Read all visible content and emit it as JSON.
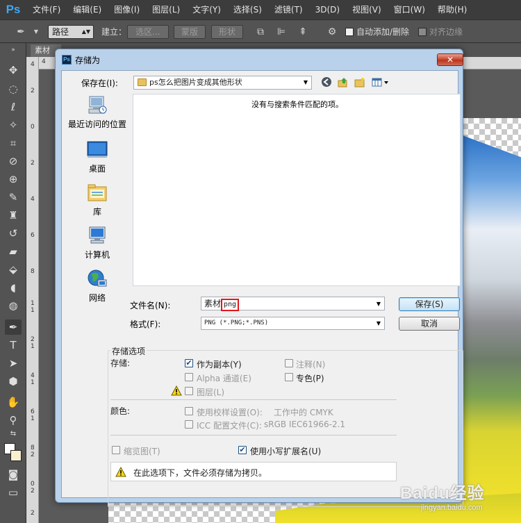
{
  "menubar": {
    "logo": "Ps",
    "items": [
      "文件(F)",
      "编辑(E)",
      "图像(I)",
      "图层(L)",
      "文字(Y)",
      "选择(S)",
      "滤镜(T)",
      "3D(D)",
      "视图(V)",
      "窗口(W)",
      "帮助(H)"
    ]
  },
  "options_bar": {
    "mode_select": "路径",
    "make_label": "建立：",
    "selection_btn": "选区...",
    "mask_btn": "蒙版",
    "shape_btn": "形状",
    "auto_add_delete": "自动添加/删除",
    "align_edges": "对齐边缘"
  },
  "document": {
    "tab_label": "素材",
    "ruler_v": [
      "4",
      "2",
      "0",
      "2",
      "4",
      "6",
      "8",
      "1",
      "1",
      "2",
      "1",
      "4",
      "1",
      "6",
      "1",
      "8",
      "2",
      "0",
      "2",
      "2"
    ],
    "ruler_h_first": "4"
  },
  "dialog": {
    "title": "存储为",
    "close_symbol": "✕",
    "save_in_label": "保存在(I):",
    "location": "ps怎么把图片变成其他形状",
    "places": [
      "最近访问的位置",
      "桌面",
      "库",
      "计算机",
      "网络"
    ],
    "empty_message": "没有与搜索条件匹配的项。",
    "filename_label": "文件名(N):",
    "filename_prefix": "素材",
    "filename_ext": "png",
    "format_label": "格式(F):",
    "format_value": "PNG (*.PNG;*.PNS)",
    "save_button": "保存(S)",
    "cancel_button": "取消",
    "options": {
      "group_title": "存储选项",
      "storage_label": "存储:",
      "as_copy": "作为副本(Y)",
      "notes": "注释(N)",
      "alpha": "Alpha 通道(E)",
      "spot": "专色(P)",
      "layers": "图层(L)",
      "color_label": "颜色:",
      "proof": "使用校样设置(O):",
      "proof_value": "工作中的 CMYK",
      "icc": "ICC 配置文件(C):",
      "icc_value": "sRGB IEC61966-2.1",
      "thumbnail": "缩览图(T)",
      "lowercase_ext": "使用小写扩展名(U)",
      "as_copy_checked": true,
      "lowercase_checked": true
    },
    "status_message": "在此选项下，文件必须存储为拷贝。"
  },
  "watermark": {
    "brand": "Baidu经验",
    "url": "jingyan.baidu.com"
  }
}
